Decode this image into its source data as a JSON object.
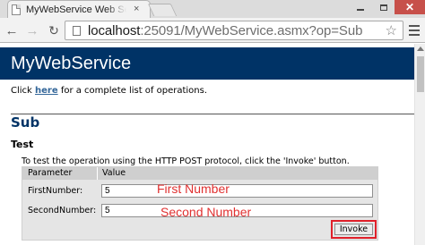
{
  "browser": {
    "tab_title": "MyWebService Web Service",
    "tab_close": "×",
    "url_host": "localhost",
    "url_rest": ":25091/MyWebService.asmx?op=Sub",
    "window_controls": {
      "close": "✕"
    },
    "icons": {
      "back": "arrow-left-icon",
      "forward": "arrow-right-icon",
      "reload": "reload-icon",
      "bookmark": "star-icon",
      "menu": "hamburger-menu-icon"
    }
  },
  "page": {
    "banner_title": "MyWebService",
    "intro_prefix": "Click ",
    "intro_link": "here",
    "intro_suffix": " for a complete list of operations.",
    "operation_name": "Sub",
    "test_heading": "Test",
    "instructions": "To test the operation using the HTTP POST protocol, click the 'Invoke' button.",
    "form": {
      "header_parameter": "Parameter",
      "header_value": "Value",
      "fields": [
        {
          "label": "FirstNumber:",
          "value": "5"
        },
        {
          "label": "SecondNumber:",
          "value": "5"
        }
      ],
      "invoke_label": "Invoke"
    },
    "annotations": {
      "first": "First Number",
      "second": "Second Number"
    }
  },
  "colors": {
    "banner_bg": "#003366",
    "link": "#336699",
    "annotation": "#e03030",
    "highlight_frame": "#e0202a"
  }
}
